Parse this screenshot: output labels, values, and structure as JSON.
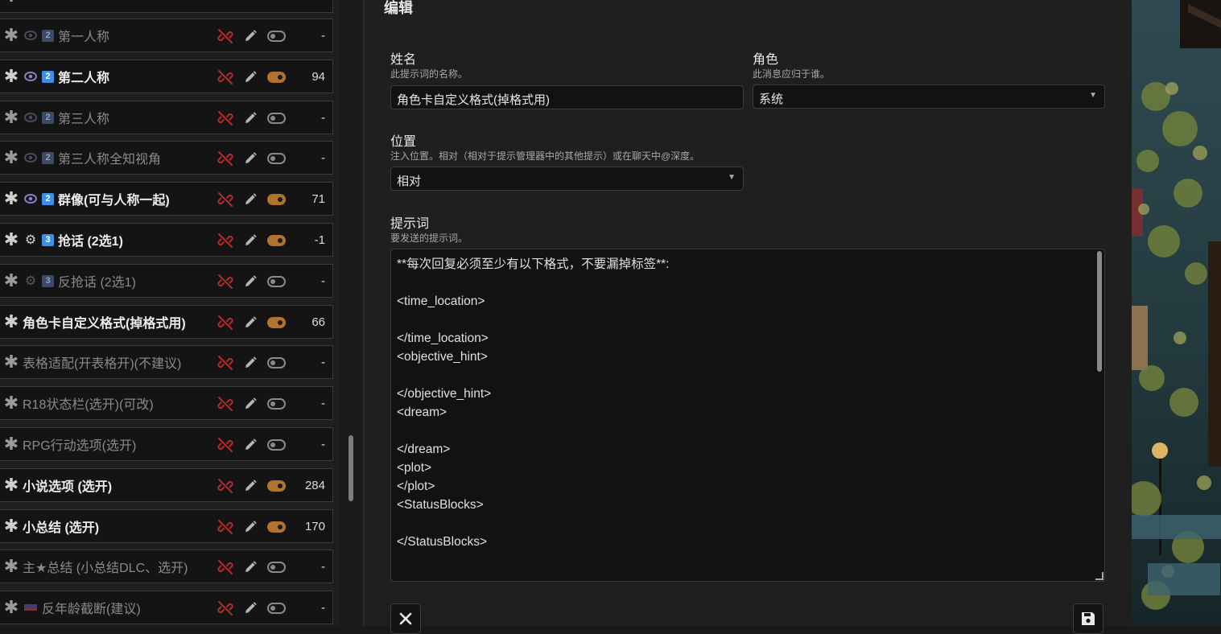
{
  "prompt_list": {
    "items": [
      {
        "name": "第一人称",
        "enabled": false,
        "icon": "eye-icon",
        "badge": "2",
        "tokens": "-"
      },
      {
        "name": "第二人称",
        "enabled": true,
        "icon": "eye-icon",
        "badge": "2",
        "tokens": "94"
      },
      {
        "name": "第三人称",
        "enabled": false,
        "icon": "eye-icon",
        "badge": "2",
        "tokens": "-"
      },
      {
        "name": "第三人称全知视角",
        "enabled": false,
        "icon": "eye-icon",
        "badge": "2",
        "tokens": "-"
      },
      {
        "name": "群像(可与人称一起)",
        "enabled": true,
        "icon": "eye-icon",
        "badge": "2",
        "tokens": "71"
      },
      {
        "name": "抢话 (2选1)",
        "enabled": true,
        "icon": "gear-icon",
        "badge": "3",
        "tokens": "-1"
      },
      {
        "name": "反抢话 (2选1)",
        "enabled": false,
        "icon": "gear-icon",
        "badge": "3",
        "tokens": "-"
      },
      {
        "name": "角色卡自定义格式(掉格式用)",
        "enabled": true,
        "icon": "",
        "badge": "",
        "tokens": "66"
      },
      {
        "name": "表格适配(开表格开)(不建议)",
        "enabled": false,
        "icon": "",
        "badge": "",
        "tokens": "-"
      },
      {
        "name": "R18状态栏(选开)(可改)",
        "enabled": false,
        "icon": "",
        "badge": "",
        "tokens": "-"
      },
      {
        "name": "RPG行动选项(选开)",
        "enabled": false,
        "icon": "",
        "badge": "",
        "tokens": "-"
      },
      {
        "name": "小说选项 (选开)",
        "enabled": true,
        "icon": "",
        "badge": "",
        "tokens": "284"
      },
      {
        "name": "小总结 (选开)",
        "enabled": true,
        "icon": "",
        "badge": "",
        "tokens": "170"
      },
      {
        "name": "主★总结 (小总结DLC、选开)",
        "enabled": false,
        "icon": "",
        "badge": "",
        "tokens": "-"
      },
      {
        "name": "反年龄截断(建议)",
        "enabled": false,
        "icon": "flag-icon",
        "badge": "",
        "tokens": "-"
      }
    ]
  },
  "editor": {
    "title": "编辑",
    "name_label": "姓名",
    "name_hint": "此提示词的名称。",
    "name_value": "角色卡自定义格式(掉格式用)",
    "role_label": "角色",
    "role_hint": "此消息应归于谁。",
    "role_value": "系统",
    "position_label": "位置",
    "position_hint": "注入位置。相对（相对于提示管理器中的其他提示）或在聊天中@深度。",
    "position_value": "相对",
    "prompt_label": "提示词",
    "prompt_hint": "要发送的提示词。",
    "prompt_text": "**每次回复必须至少有以下格式，不要漏掉标签**:\n\n<time_location>\n\n</time_location>\n<objective_hint>\n\n</objective_hint>\n<dream>\n\n</dream>\n<plot>\n</plot>\n<StatusBlocks>\n\n</StatusBlocks>",
    "close_icon": "close-icon",
    "save_icon": "save-icon"
  },
  "colors": {
    "toggle_on": "#b07330",
    "badge": "#3d8fe6",
    "link_off": "#b52b2b"
  }
}
